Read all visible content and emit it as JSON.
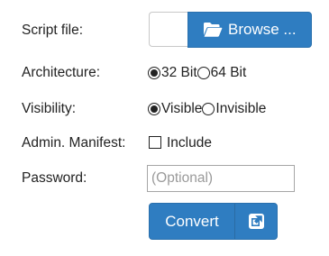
{
  "form": {
    "script_file": {
      "label": "Script file:",
      "browse_label": "Browse ...",
      "icon": "folder-open-icon"
    },
    "architecture": {
      "label": "Architecture:",
      "options": [
        "32 Bit",
        "64 Bit"
      ],
      "selected": "32 Bit"
    },
    "visibility": {
      "label": "Visibility:",
      "options": [
        "Visible",
        "Invisible"
      ],
      "selected": "Visible"
    },
    "admin_manifest": {
      "label": "Admin. Manifest:",
      "checkbox_label": "Include",
      "checked": false
    },
    "password": {
      "label": "Password:",
      "value": "",
      "placeholder": "(Optional)"
    },
    "convert": {
      "label": "Convert",
      "icon": "external-link-icon"
    }
  },
  "colors": {
    "primary": "#2f7dc1",
    "primary_border": "#2a70ad",
    "text": "#222222",
    "placeholder": "#9a9a9a"
  }
}
